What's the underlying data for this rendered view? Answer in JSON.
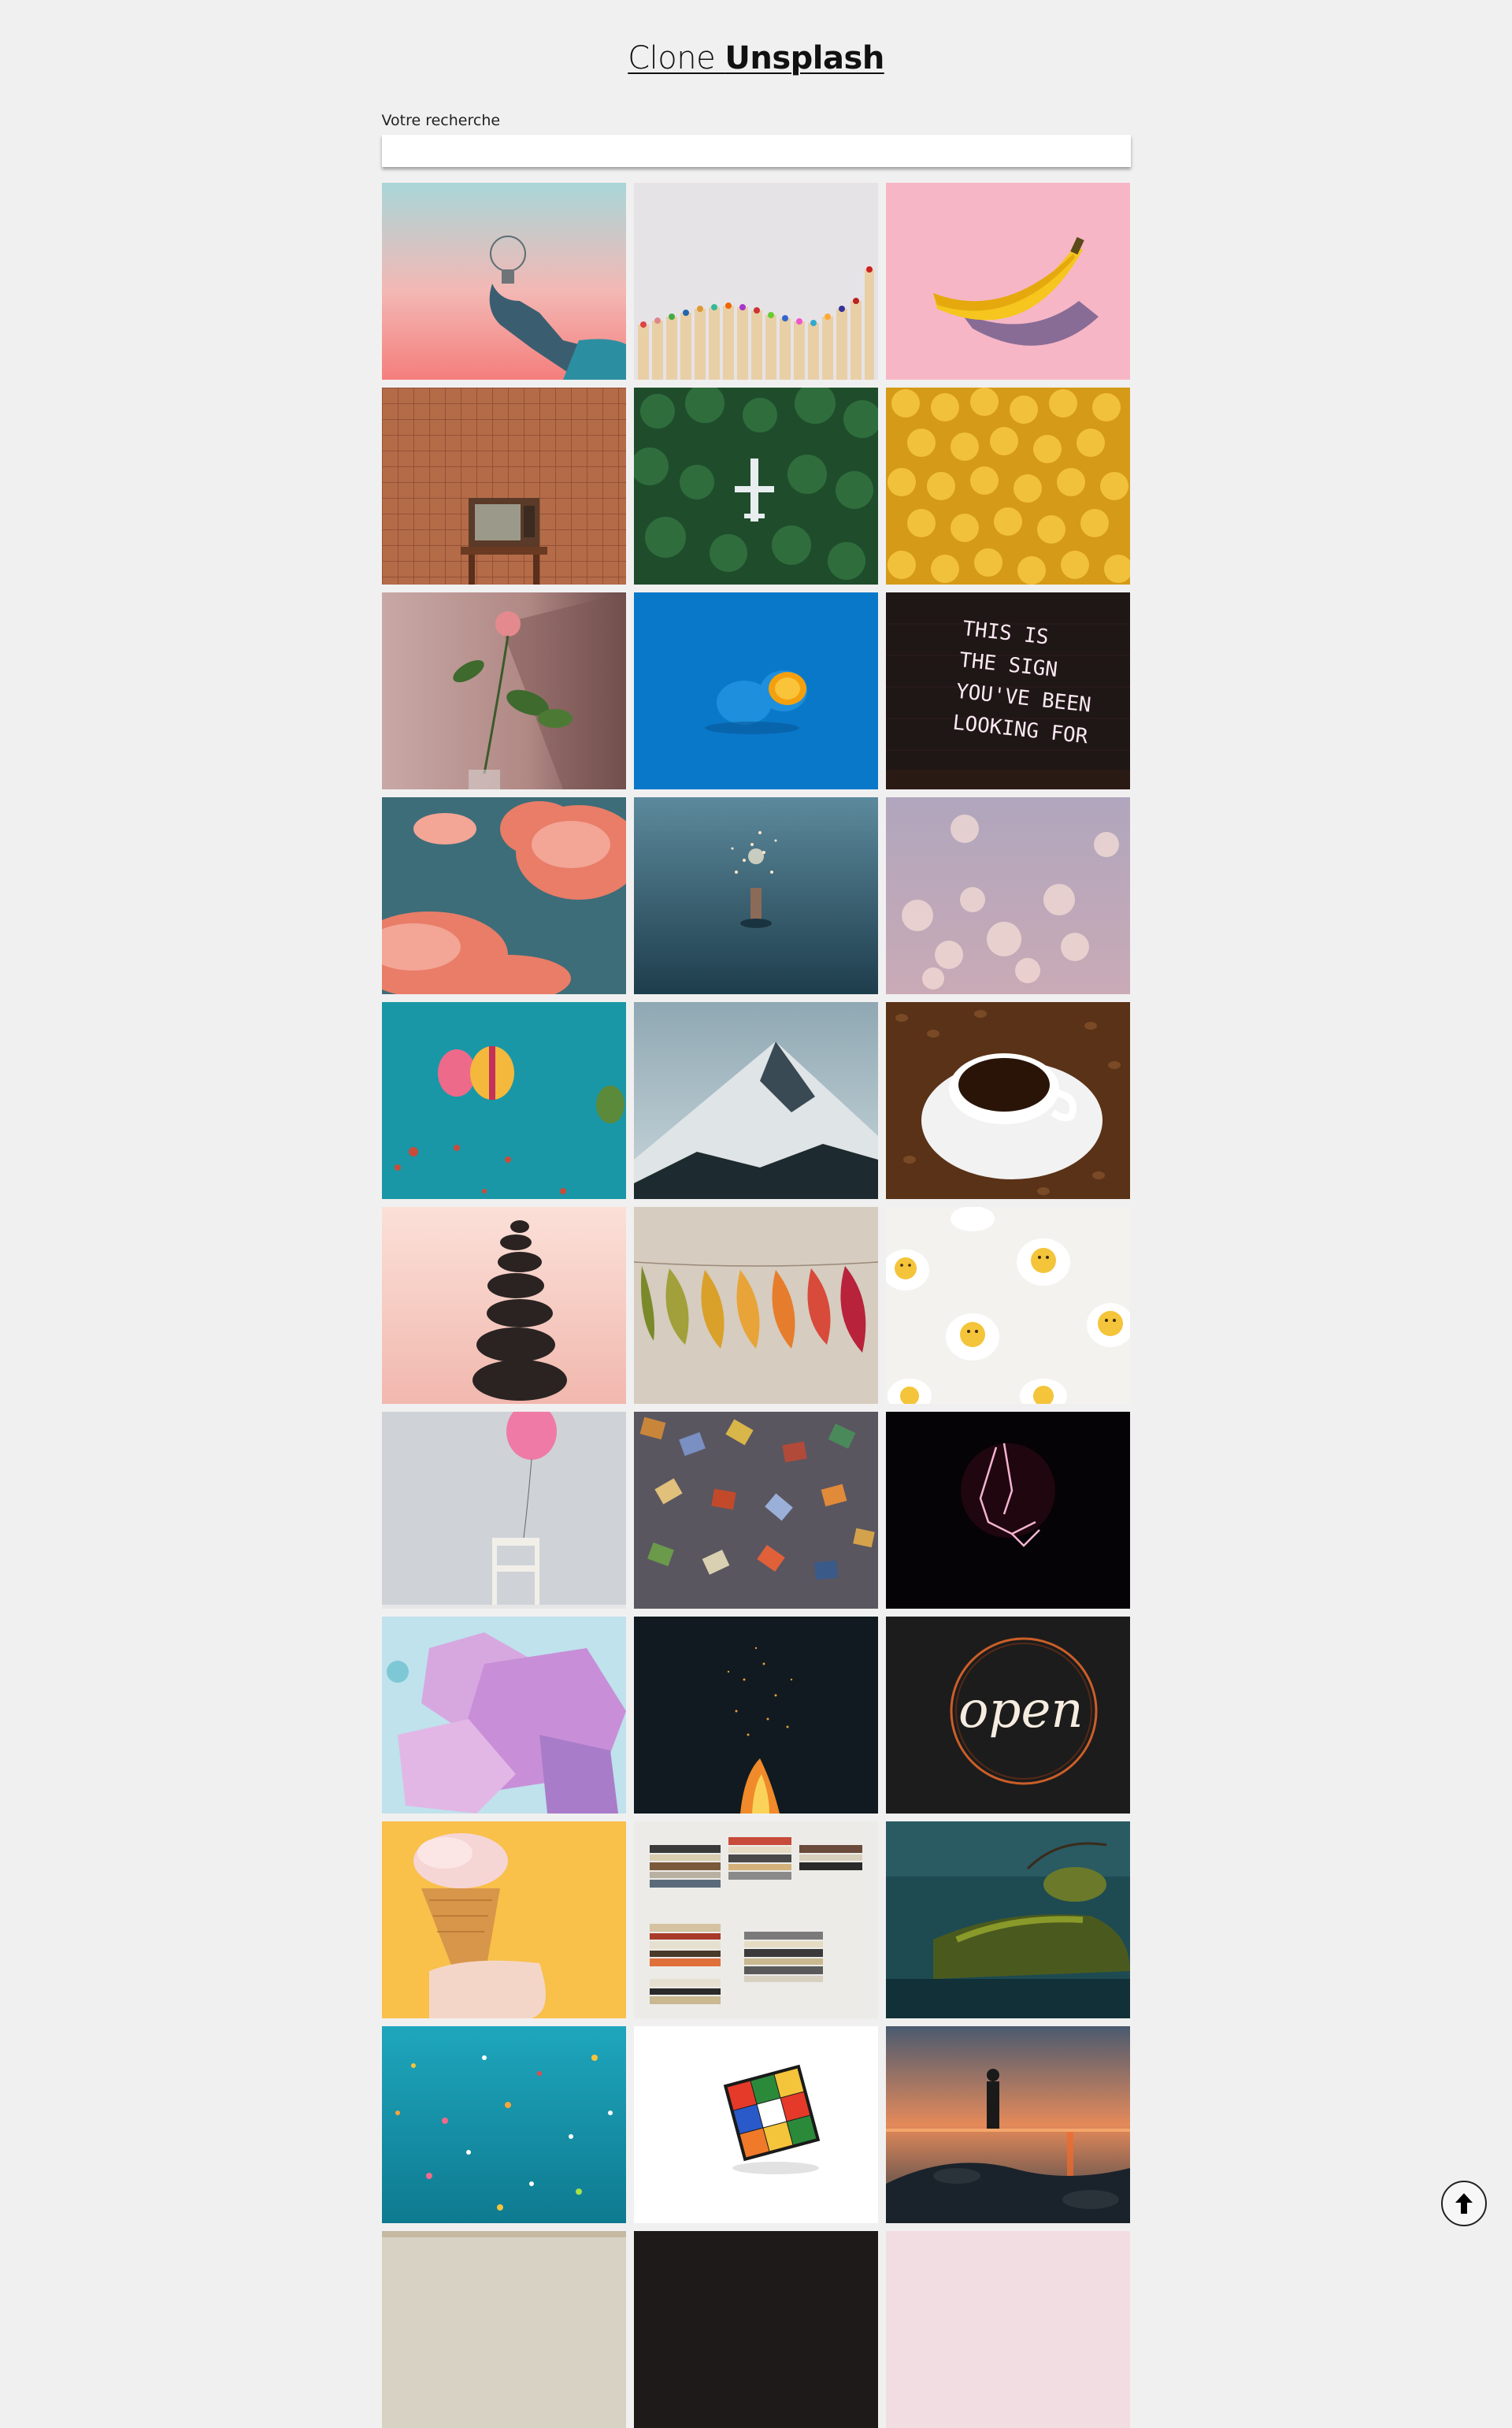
{
  "header": {
    "title_light": "Clone ",
    "title_bold": "Unsplash"
  },
  "search": {
    "label": "Votre recherche",
    "value": "",
    "placeholder": ""
  },
  "gallery": {
    "photos": [
      {
        "subject": "light-bulb"
      },
      {
        "subject": "colored-pencils"
      },
      {
        "subject": "banana"
      },
      {
        "subject": "retro-tv"
      },
      {
        "subject": "airplane-forest"
      },
      {
        "subject": "yellow-lego-heads"
      },
      {
        "subject": "rose"
      },
      {
        "subject": "blue-lemon"
      },
      {
        "subject": "neon-sign-text"
      },
      {
        "subject": "pink-clouds"
      },
      {
        "subject": "sparkler-sea"
      },
      {
        "subject": "bokeh-lights"
      },
      {
        "subject": "hot-air-balloons"
      },
      {
        "subject": "snowy-mountain"
      },
      {
        "subject": "coffee-cup"
      },
      {
        "subject": "stacked-stones"
      },
      {
        "subject": "autumn-leaves"
      },
      {
        "subject": "smiley-eggs"
      },
      {
        "subject": "pink-balloon-chair"
      },
      {
        "subject": "puzzle-pieces"
      },
      {
        "subject": "neon-praying-hands"
      },
      {
        "subject": "crystals"
      },
      {
        "subject": "campfire"
      },
      {
        "subject": "neon-open-sign"
      },
      {
        "subject": "ice-cream-cone"
      },
      {
        "subject": "book-stacks"
      },
      {
        "subject": "coastal-tree"
      },
      {
        "subject": "confetti"
      },
      {
        "subject": "rubiks-cube"
      },
      {
        "subject": "sunset-person"
      },
      {
        "subject": "partial-row-1"
      },
      {
        "subject": "partial-row-2"
      },
      {
        "subject": "partial-row-3"
      }
    ],
    "neon_sign_text": [
      "THIS IS",
      "THE SIGN",
      "YOU'VE BEEN",
      "LOOKING FOR"
    ],
    "open_sign_text": "open"
  },
  "scroll_top": {
    "icon": "arrow-up-icon"
  },
  "colors": {
    "background": "#f1f0f0",
    "input_bg": "#ffffff"
  }
}
